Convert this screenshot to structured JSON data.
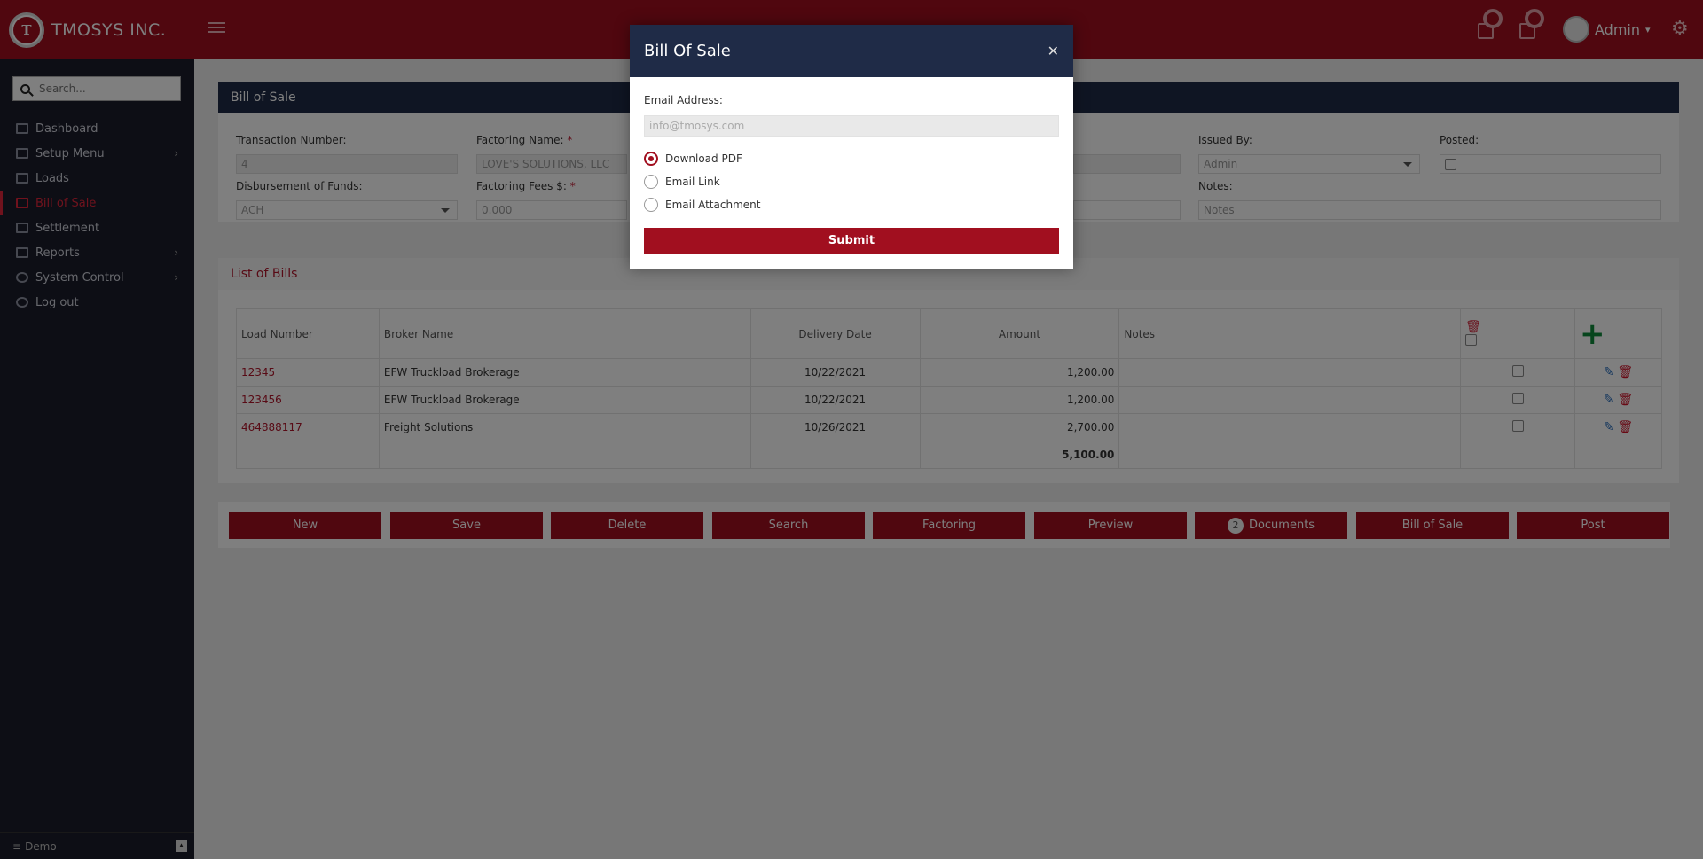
{
  "app": {
    "name": "TMOSYS INC.",
    "logo_glyph": "T"
  },
  "header": {
    "user": "Admin",
    "user_avatar_text": "",
    "icons": [
      "documents-badge-icon",
      "edit-badge-icon",
      "gear-icon"
    ]
  },
  "sidebar": {
    "search_placeholder": "Search...",
    "items": [
      {
        "label": "Dashboard",
        "icon": "chart-icon",
        "active": false,
        "has_children": false
      },
      {
        "label": "Setup Menu",
        "icon": "setup-icon",
        "active": false,
        "has_children": true
      },
      {
        "label": "Loads",
        "icon": "loads-icon",
        "active": false,
        "has_children": false
      },
      {
        "label": "Bill of Sale",
        "icon": "bill-icon",
        "active": true,
        "has_children": false
      },
      {
        "label": "Settlement",
        "icon": "settlement-icon",
        "active": false,
        "has_children": false
      },
      {
        "label": "Reports",
        "icon": "reports-icon",
        "active": false,
        "has_children": true
      },
      {
        "label": "System Control",
        "icon": "gear-icon",
        "active": false,
        "has_children": true
      },
      {
        "label": "Log out",
        "icon": "power-icon",
        "active": false,
        "has_children": false
      }
    ],
    "footer": "Demo"
  },
  "form": {
    "title": "Bill of Sale",
    "transaction_number_label": "Transaction Number:",
    "transaction_number": "4",
    "factoring_name_label": "Factoring Name:",
    "factoring_name": "LOVE'S SOLUTIONS, LLC",
    "disbursement_label": "Disbursement of Funds:",
    "disbursement": "ACH",
    "factoring_fees_label": "Factoring Fees $:",
    "factoring_fees": "0.000",
    "issued_by_label": "Issued By:",
    "issued_by": "Admin",
    "posted_label": "Posted:",
    "notes_label": "Notes:",
    "notes_placeholder": "Notes",
    "required_mark": "*"
  },
  "bills": {
    "title": "List of Bills",
    "columns": [
      "Load Number",
      "Broker Name",
      "Delivery Date",
      "Amount",
      "Notes"
    ],
    "rows": [
      {
        "load": "12345",
        "broker": "EFW Truckload Brokerage",
        "date": "10/22/2021",
        "amount": "1,200.00",
        "notes": ""
      },
      {
        "load": "123456",
        "broker": "EFW Truckload Brokerage",
        "date": "10/22/2021",
        "amount": "1,200.00",
        "notes": ""
      },
      {
        "load": "464888117",
        "broker": "Freight Solutions",
        "date": "10/26/2021",
        "amount": "2,700.00",
        "notes": ""
      }
    ],
    "total": "5,100.00"
  },
  "actions": {
    "new": "New",
    "save": "Save",
    "delete": "Delete",
    "search": "Search",
    "factoring": "Factoring",
    "preview": "Preview",
    "documents": "Documents",
    "documents_count": "2",
    "bill_of_sale": "Bill of Sale",
    "post": "Post"
  },
  "modal": {
    "title": "Bill Of Sale",
    "email_label": "Email Address:",
    "email_value": "info@tmosys.com",
    "options": [
      "Download PDF",
      "Email Link",
      "Email Attachment"
    ],
    "selected": "Download PDF",
    "submit": "Submit",
    "close": "✕"
  },
  "colors": {
    "brand": "#a10f1f",
    "header_navy": "#1f2b47",
    "sidebar": "#1b1d2a"
  }
}
